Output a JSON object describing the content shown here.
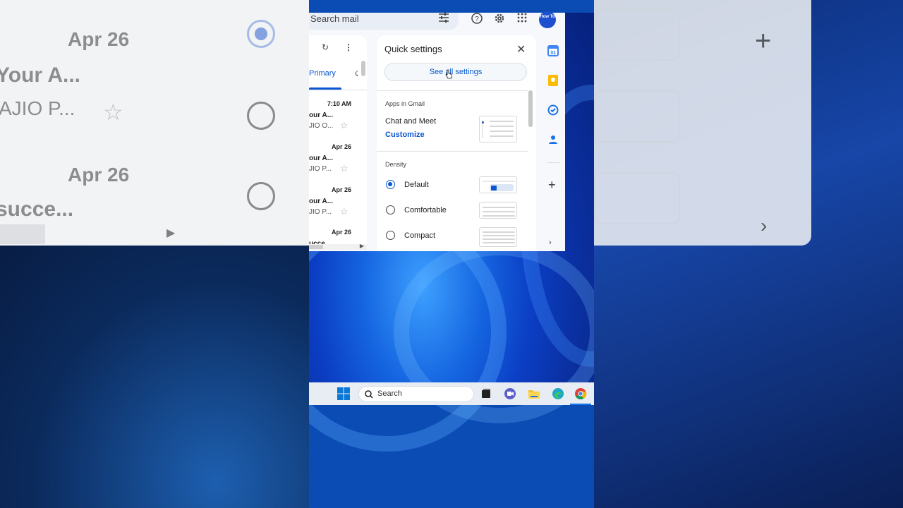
{
  "background_left": {
    "dates": [
      "Apr 26",
      "Apr 26"
    ],
    "senders": [
      "Your A...",
      "succe..."
    ],
    "snippet": "AJIO P..."
  },
  "gmail": {
    "search_placeholder": "Search mail",
    "avatar_text": "How To",
    "mail_list": {
      "tab_label": "Primary",
      "rows": [
        {
          "date": "7:10 AM",
          "sender": "our A...",
          "snippet": "JIO O..."
        },
        {
          "date": "Apr 26",
          "sender": "our A...",
          "snippet": "JIO P..."
        },
        {
          "date": "Apr 26",
          "sender": "our A...",
          "snippet": "JIO P..."
        },
        {
          "date": "Apr 26",
          "sender": "ucce...",
          "snippet": ""
        }
      ]
    },
    "quick_settings": {
      "title": "Quick settings",
      "see_all_label": "See all settings",
      "apps_section_label": "Apps in Gmail",
      "apps_item": "Chat and Meet",
      "customize_label": "Customize",
      "density_label": "Density",
      "density_options": [
        {
          "label": "Default",
          "selected": true
        },
        {
          "label": "Comfortable",
          "selected": false
        },
        {
          "label": "Compact",
          "selected": false
        }
      ]
    },
    "side_rail_icons": [
      "calendar-icon",
      "keep-icon",
      "tasks-icon",
      "contacts-icon",
      "plus-icon"
    ],
    "calendar_day": "31"
  },
  "taskbar": {
    "search_label": "Search",
    "icons": [
      "windows-start-icon",
      "search-icon",
      "task-view-icon",
      "teams-icon",
      "file-explorer-icon",
      "edge-icon",
      "chrome-icon"
    ]
  },
  "colors": {
    "accent": "#0b57d0",
    "desktop": "#0a4bb4"
  }
}
